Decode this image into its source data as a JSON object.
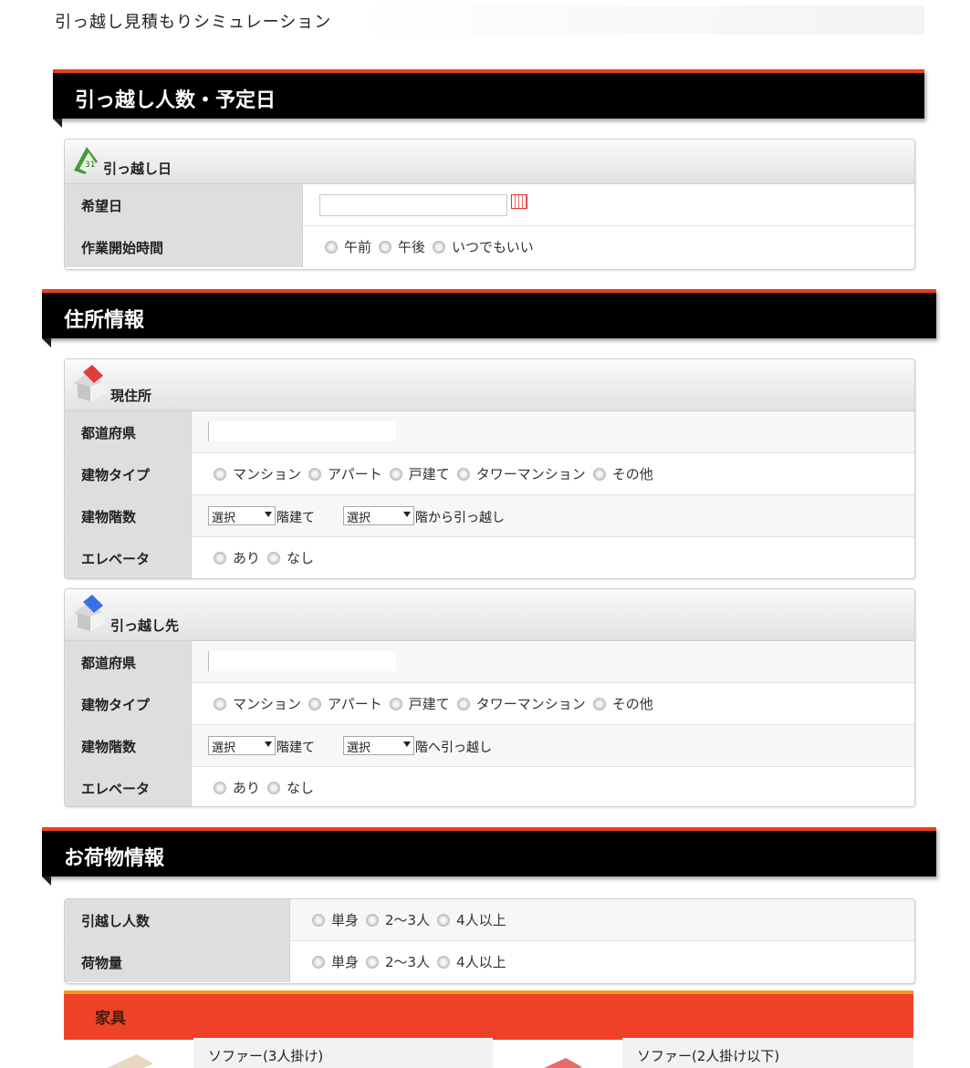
{
  "page_title": "引っ越し見積もりシミュレーション",
  "colors": {
    "accent_red": "#e8411c",
    "header_black": "#000000",
    "kagu_red": "#ef4128",
    "kagu_orange": "#f39a1c"
  },
  "section1": {
    "title": "引っ越し人数・予定日",
    "panel": {
      "title": "引っ越し日",
      "icon": "calendar-icon",
      "rows": [
        {
          "label": "希望日",
          "value": ""
        },
        {
          "label": "作業開始時間",
          "options": [
            "午前",
            "午後",
            "いつでもいい"
          ]
        }
      ]
    }
  },
  "section2": {
    "title": "住所情報",
    "current": {
      "title": "現住所",
      "icon": "house-red-icon",
      "prefecture_label": "都道府県",
      "building_type_label": "建物タイプ",
      "building_types": [
        "マンション",
        "アパート",
        "戸建て",
        "タワーマンション",
        "その他"
      ],
      "floors_label": "建物階数",
      "select_default": "選択",
      "floors_text_1": "階建て",
      "floors_text_2": "階から引っ越し",
      "elevator_label": "エレベータ",
      "elevator_options": [
        "あり",
        "なし"
      ]
    },
    "destination": {
      "title": "引っ越し先",
      "icon": "house-blue-icon",
      "prefecture_label": "都道府県",
      "building_type_label": "建物タイプ",
      "building_types": [
        "マンション",
        "アパート",
        "戸建て",
        "タワーマンション",
        "その他"
      ],
      "floors_label": "建物階数",
      "select_default": "選択",
      "floors_text_1": "階建て",
      "floors_text_2": "階へ引っ越し",
      "elevator_label": "エレベータ",
      "elevator_options": [
        "あり",
        "なし"
      ]
    }
  },
  "section3": {
    "title": "お荷物情報",
    "rows": [
      {
        "label": "引越し人数",
        "options": [
          "単身",
          "2〜3人",
          "4人以上"
        ]
      },
      {
        "label": "荷物量",
        "options": [
          "単身",
          "2〜3人",
          "4人以上"
        ]
      }
    ],
    "furniture": {
      "title": "家具",
      "items": [
        "ソファー(3人掛け)",
        "ソファー(2人掛け以下)"
      ]
    }
  }
}
